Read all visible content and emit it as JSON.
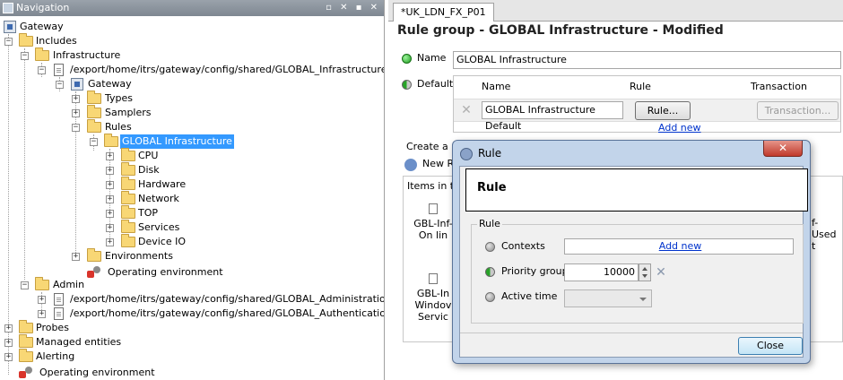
{
  "nav": {
    "title": "Navigation",
    "window_buttons": "▫ ✕ ▪ ✕"
  },
  "tree": [
    {
      "label": "Gateway"
    },
    {
      "label": "Includes"
    },
    {
      "label": "Infrastructure"
    },
    {
      "label": "/export/home/itrs/gateway/config/shared/GLOBAL_Infrastructure.xml"
    },
    {
      "label": "Gateway"
    },
    {
      "label": "Types"
    },
    {
      "label": "Samplers"
    },
    {
      "label": "Rules"
    },
    {
      "label": "GLOBAL Infrastructure"
    },
    {
      "label": "CPU"
    },
    {
      "label": "Disk"
    },
    {
      "label": "Hardware"
    },
    {
      "label": "Network"
    },
    {
      "label": "TOP"
    },
    {
      "label": "Services"
    },
    {
      "label": "Device IO"
    },
    {
      "label": "Environments"
    },
    {
      "label": "Operating environment"
    },
    {
      "label": "Admin"
    },
    {
      "label": "/export/home/itrs/gateway/config/shared/GLOBAL_Administration.xml"
    },
    {
      "label": "/export/home/itrs/gateway/config/shared/GLOBAL_Authentication.xml"
    },
    {
      "label": "Probes"
    },
    {
      "label": "Managed entities"
    },
    {
      "label": "Alerting"
    },
    {
      "label": "Operating environment"
    }
  ],
  "editor": {
    "tab_label": "*UK_LDN_FX_P01",
    "heading": "Rule group - GLOBAL Infrastructure - Modified",
    "name_label": "Name",
    "name_value": "GLOBAL Infrastructure",
    "default_label": "Default",
    "table_headers": {
      "name": "Name",
      "rule": "Rule",
      "transaction": "Transaction"
    },
    "row_name_value": "GLOBAL Infrastructure Default",
    "rule_button": "Rule...",
    "transaction_button": "Transaction...",
    "add_new": "Add new",
    "create_label": "Create a n",
    "new_rule_label": "New Ru",
    "items_label": "Items in th",
    "bg_item1_line1": "GBL-Inf-",
    "bg_item1_line2": "On lin",
    "bg_item2_line1": "GBL-In",
    "bg_item2_line2": "Windov",
    "bg_item2_line3": "Servic",
    "bg_right_1": "f-",
    "bg_right_2": "Used",
    "bg_right_3": "t"
  },
  "dialog": {
    "title": "Rule",
    "close_glyph": "✕",
    "header": "Rule",
    "group_label": "Rule",
    "contexts_label": "Contexts",
    "contexts_link": "Add new",
    "priority_label": "Priority group",
    "priority_value": "10000",
    "active_time_label": "Active time",
    "close_button": "Close"
  }
}
